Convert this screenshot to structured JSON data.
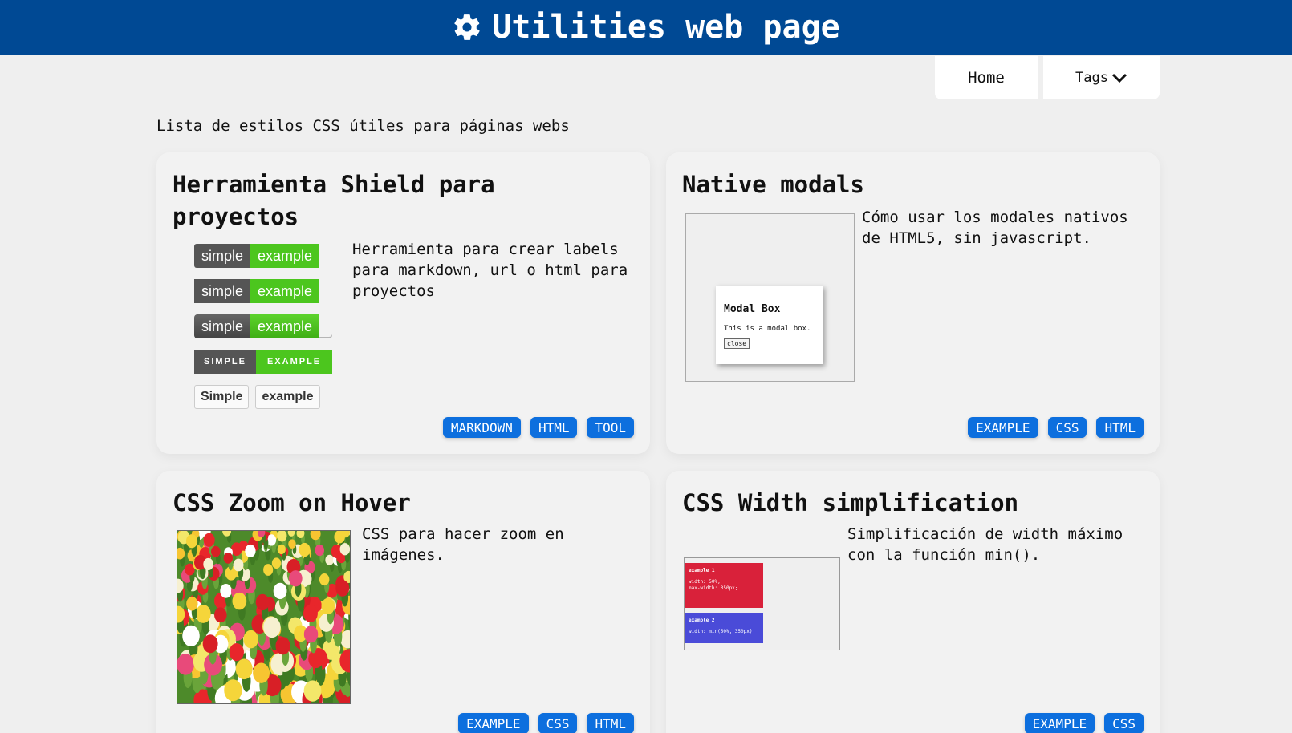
{
  "header": {
    "title": "Utilities web page",
    "icon": "gear-icon"
  },
  "nav": {
    "home_label": "Home",
    "tags_label": "Tags"
  },
  "intro": "Lista de estilos CSS útiles para páginas webs",
  "cards": [
    {
      "title": "Herramienta Shield para proyectos",
      "description": "Herramienta para crear labels para markdown, url o html para proyectos",
      "badges": [
        {
          "left": "simple",
          "right": "example"
        },
        {
          "left": "simple",
          "right": "example"
        },
        {
          "left": "simple",
          "right": "example"
        },
        {
          "left": "SIMPLE",
          "right": "EXAMPLE"
        },
        {
          "left": "Simple",
          "right": "example"
        }
      ],
      "tags": [
        "MARKDOWN",
        "HTML",
        "TOOL"
      ]
    },
    {
      "title": "Native modals",
      "description": "Cómo usar los modales nativos de HTML5, sin javascript.",
      "preview": {
        "modal_title": "Modal Box",
        "modal_text": "This is a modal box.",
        "close_label": "close"
      },
      "tags": [
        "EXAMPLE",
        "CSS",
        "HTML"
      ]
    },
    {
      "title": "CSS Zoom on Hover",
      "description": "CSS para hacer zoom en imágenes.",
      "tags": [
        "EXAMPLE",
        "CSS",
        "HTML"
      ]
    },
    {
      "title": "CSS Width simplification",
      "description": "Simplificación de width máximo con la función min().",
      "preview": {
        "box1_title": "example 1",
        "box1_line1": "width: 50%;",
        "box1_line2": "max-width: 350px;",
        "box2_title": "example 2",
        "box2_line1": "width: min(50%, 350px)"
      },
      "tags": [
        "EXAMPLE",
        "CSS"
      ]
    }
  ],
  "colors": {
    "header": "#004994",
    "tag": "#0d6fde",
    "badge_green": "#4cc61e",
    "badge_gray": "#555555"
  }
}
